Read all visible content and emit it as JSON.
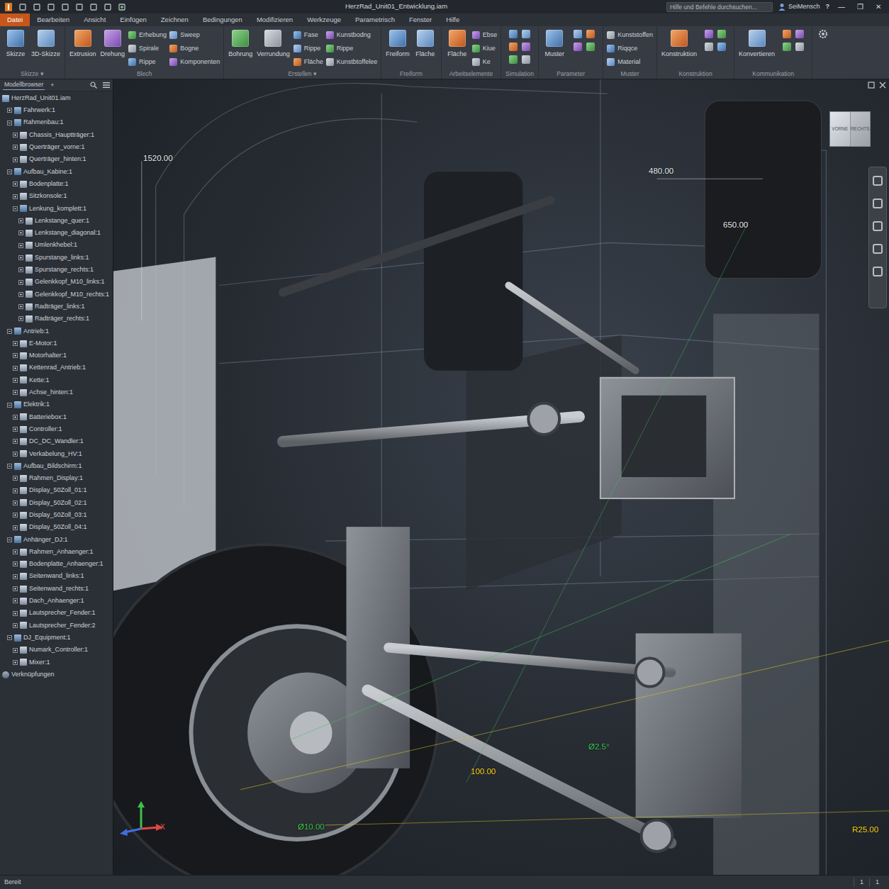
{
  "window": {
    "title": "HerzRad_Unit01_Entwicklung.iam",
    "search_placeholder": "Hilfe und Befehle durchsuchen...",
    "user": "SeiMensch",
    "help": "?",
    "controls": [
      "—",
      "❐",
      "✕"
    ]
  },
  "menu": [
    {
      "label": "Datei",
      "selected": true
    },
    {
      "label": "Bearbeiten",
      "selected": false
    },
    {
      "label": "Ansicht",
      "selected": false
    },
    {
      "label": "Einfügen",
      "selected": false
    },
    {
      "label": "Zeichnen",
      "selected": false
    },
    {
      "label": "Bedingungen",
      "selected": false
    },
    {
      "label": "Modifizieren",
      "selected": false
    },
    {
      "label": "Werkzeuge",
      "selected": false
    },
    {
      "label": "Parametrisch",
      "selected": false
    },
    {
      "label": "Fenster",
      "selected": false
    },
    {
      "label": "Hilfe",
      "selected": false
    }
  ],
  "ribbon": [
    {
      "label": "Skizze ▾",
      "large": [
        "Skizze",
        "3D-Skizze"
      ],
      "small": []
    },
    {
      "label": "Blech",
      "large": [
        "Extrusion",
        "Drehung"
      ],
      "small": [
        "Erhebung",
        "Spirale",
        "Rippe",
        "Sweep",
        "Bogne",
        "Komponenten"
      ]
    },
    {
      "label": "Erstellen ▾",
      "large": [
        "Bohrung",
        "Verrundung"
      ],
      "small": [
        "Fase",
        "Rippe",
        "Fläche",
        "Kunstbodng",
        "Rippe",
        "Kunstbtoffelee"
      ]
    },
    {
      "label": "Freiform",
      "large": [
        "Freiform",
        "Fläche"
      ],
      "small": []
    },
    {
      "label": "Arbeitselemente",
      "large": [
        "Fläche"
      ],
      "small": [
        "Ebse",
        "Kiue",
        "Ke"
      ]
    },
    {
      "label": "Simulation",
      "large": [],
      "small": []
    },
    {
      "label": "Parameter",
      "large": [
        "Muster"
      ],
      "small": []
    },
    {
      "label": "Muster",
      "large": [],
      "small": [
        "Kunststoffen",
        "Riqqce",
        "Material"
      ]
    },
    {
      "label": "Konstruktion",
      "large": [
        "Konstruktion"
      ],
      "small": []
    },
    {
      "label": "Kommunikation",
      "large": [
        "Konvertieren"
      ],
      "small": []
    }
  ],
  "browser": {
    "title": "Modellbrowser",
    "add": "+",
    "items": [
      {
        "label": "HerzRad_Unit01.iam",
        "level": 0,
        "kind": "root",
        "expanded": true
      },
      {
        "label": "Fahrwerk:1",
        "level": 1,
        "kind": "assembly",
        "expanded": false
      },
      {
        "label": "Rahmenbau:1",
        "level": 1,
        "kind": "assembly",
        "expanded": true
      },
      {
        "label": "Chassis_Hauptträger:1",
        "level": 2,
        "kind": "part",
        "expanded": false
      },
      {
        "label": "Querträger_vorne:1",
        "level": 2,
        "kind": "part",
        "expanded": false
      },
      {
        "label": "Querträger_hinten:1",
        "level": 2,
        "kind": "part",
        "expanded": false
      },
      {
        "label": "Aufbau_Kabine:1",
        "level": 1,
        "kind": "assembly",
        "expanded": true
      },
      {
        "label": "Bodenplatte:1",
        "level": 2,
        "kind": "part",
        "expanded": false
      },
      {
        "label": "Sitzkonsole:1",
        "level": 2,
        "kind": "part",
        "expanded": false
      },
      {
        "label": "Lenkung_komplett:1",
        "level": 2,
        "kind": "assembly",
        "expanded": true
      },
      {
        "label": "Lenkstange_quer:1",
        "level": 3,
        "kind": "part",
        "expanded": false
      },
      {
        "label": "Lenkstange_diagonal:1",
        "level": 3,
        "kind": "part",
        "expanded": false
      },
      {
        "label": "Umlenkhebel:1",
        "level": 3,
        "kind": "part",
        "expanded": false
      },
      {
        "label": "Spurstange_links:1",
        "level": 3,
        "kind": "part",
        "expanded": false
      },
      {
        "label": "Spurstange_rechts:1",
        "level": 3,
        "kind": "part",
        "expanded": false
      },
      {
        "label": "Gelenkkopf_M10_links:1",
        "level": 3,
        "kind": "part",
        "expanded": false
      },
      {
        "label": "Gelenkkopf_M10_rechts:1",
        "level": 3,
        "kind": "part",
        "expanded": false
      },
      {
        "label": "Radträger_links:1",
        "level": 3,
        "kind": "part",
        "expanded": false
      },
      {
        "label": "Radträger_rechts:1",
        "level": 3,
        "kind": "part",
        "expanded": false
      },
      {
        "label": "Antrieb:1",
        "level": 1,
        "kind": "assembly",
        "expanded": true
      },
      {
        "label": "E-Motor:1",
        "level": 2,
        "kind": "part",
        "expanded": false
      },
      {
        "label": "Motorhalter:1",
        "level": 2,
        "kind": "part",
        "expanded": false
      },
      {
        "label": "Kettenrad_Antrieb:1",
        "level": 2,
        "kind": "part",
        "expanded": false
      },
      {
        "label": "Kette:1",
        "level": 2,
        "kind": "part",
        "expanded": false
      },
      {
        "label": "Achse_hinten:1",
        "level": 2,
        "kind": "part",
        "expanded": false
      },
      {
        "label": "Elektrik:1",
        "level": 1,
        "kind": "assembly",
        "expanded": true
      },
      {
        "label": "Batteriebox:1",
        "level": 2,
        "kind": "part",
        "expanded": false
      },
      {
        "label": "Controller:1",
        "level": 2,
        "kind": "part",
        "expanded": false
      },
      {
        "label": "DC_DC_Wandler:1",
        "level": 2,
        "kind": "part",
        "expanded": false
      },
      {
        "label": "Verkabelung_HV:1",
        "level": 2,
        "kind": "part",
        "expanded": false
      },
      {
        "label": "Aufbau_Bildschirm:1",
        "level": 1,
        "kind": "assembly",
        "expanded": true
      },
      {
        "label": "Rahmen_Display:1",
        "level": 2,
        "kind": "part",
        "expanded": false
      },
      {
        "label": "Display_50Zoll_01:1",
        "level": 2,
        "kind": "part",
        "expanded": false
      },
      {
        "label": "Display_50Zoll_02:1",
        "level": 2,
        "kind": "part",
        "expanded": false
      },
      {
        "label": "Display_50Zoll_03:1",
        "level": 2,
        "kind": "part",
        "expanded": false
      },
      {
        "label": "Display_50Zoll_04:1",
        "level": 2,
        "kind": "part",
        "expanded": false
      },
      {
        "label": "Anhänger_DJ:1",
        "level": 1,
        "kind": "assembly",
        "expanded": true
      },
      {
        "label": "Rahmen_Anhaenger:1",
        "level": 2,
        "kind": "part",
        "expanded": false
      },
      {
        "label": "Bodenplatte_Anhaenger:1",
        "level": 2,
        "kind": "part",
        "expanded": false
      },
      {
        "label": "Seitenwand_links:1",
        "level": 2,
        "kind": "part",
        "expanded": false
      },
      {
        "label": "Seitenwand_rechts:1",
        "level": 2,
        "kind": "part",
        "expanded": false
      },
      {
        "label": "Dach_Anhaenger:1",
        "level": 2,
        "kind": "part",
        "expanded": false
      },
      {
        "label": "Lautsprecher_Fender:1",
        "level": 2,
        "kind": "part",
        "expanded": false
      },
      {
        "label": "Lautsprecher_Fender:2",
        "level": 2,
        "kind": "part",
        "expanded": false
      },
      {
        "label": "DJ_Equipment:1",
        "level": 1,
        "kind": "assembly",
        "expanded": true
      },
      {
        "label": "Numark_Controller:1",
        "level": 2,
        "kind": "part",
        "expanded": false
      },
      {
        "label": "Mixer:1",
        "level": 2,
        "kind": "part",
        "expanded": false
      },
      {
        "label": "Verknüpfungen",
        "level": 0,
        "kind": "links",
        "expanded": false
      }
    ]
  },
  "viewport": {
    "dimensions": [
      {
        "text": "1520.00",
        "color": "#e8eaed"
      },
      {
        "text": "480.00",
        "color": "#e8eaed"
      },
      {
        "text": "650.00",
        "color": "#e8eaed"
      },
      {
        "text": "100.00",
        "color": "#f2d21b"
      },
      {
        "text": "Ø10.00",
        "color": "#3fc24f"
      },
      {
        "text": "R25.00",
        "color": "#f2d21b"
      },
      {
        "text": "Ø2.5°",
        "color": "#3fc24f"
      }
    ],
    "viewcube": [
      "VORNE",
      "RECHTS"
    ],
    "axis_label": "X"
  },
  "status_bar": {
    "text": "Bereit",
    "counts": [
      "1",
      "1"
    ]
  }
}
